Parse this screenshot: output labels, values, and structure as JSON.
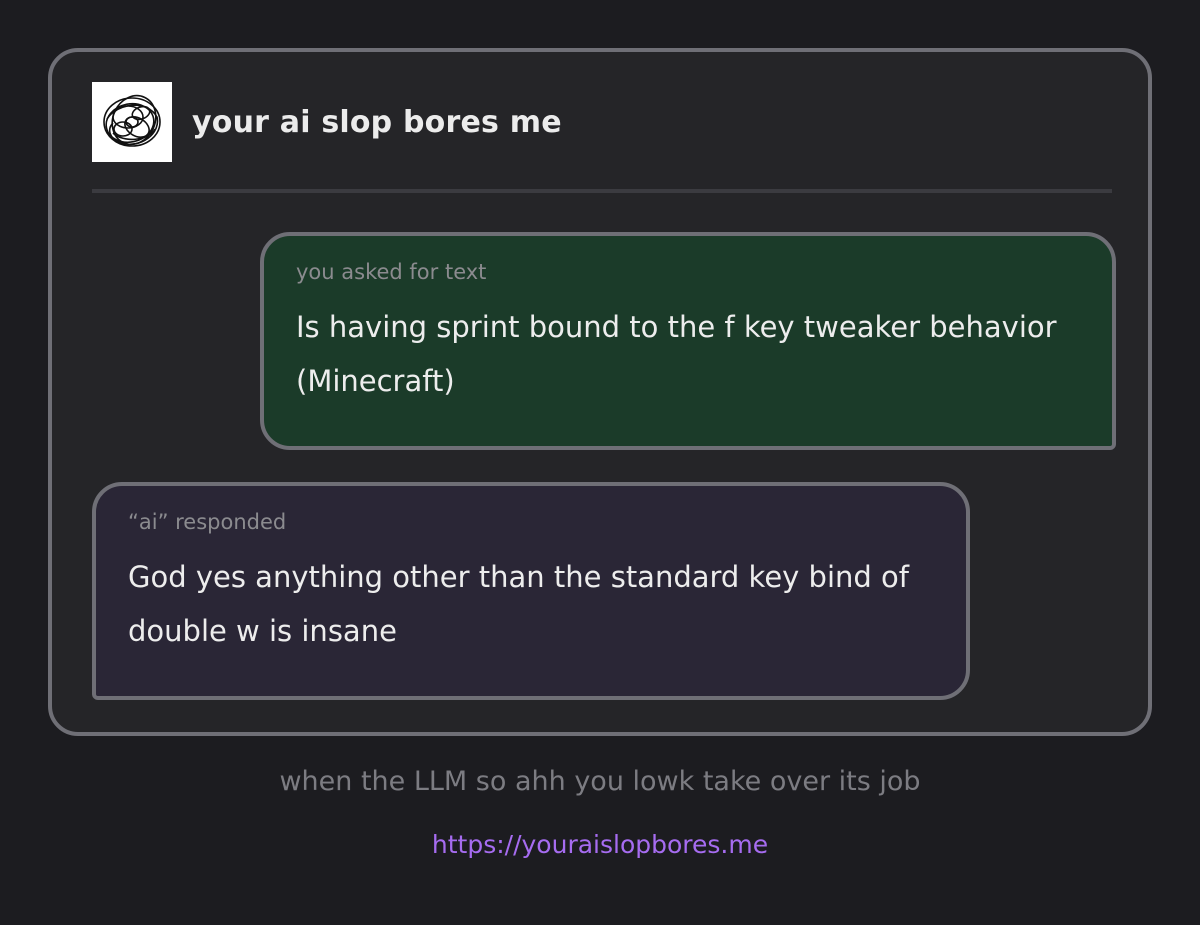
{
  "header": {
    "title": "your ai slop bores me",
    "logo_icon": "scribble-logo-icon"
  },
  "user_message": {
    "label": "you asked for text",
    "text": "Is having sprint bound to the f key tweaker behavior (Minecraft)"
  },
  "ai_message": {
    "label": "“ai” responded",
    "text": "God yes anything other than the standard key bind of double w is insane"
  },
  "footer": {
    "caption": "when the LLM so ahh you lowk take over its job",
    "link": "https://youraislopbores.me"
  },
  "colors": {
    "background": "#1c1c20",
    "card": "#252528",
    "border": "#6f6f76",
    "user_bubble": "#1b3b29",
    "ai_bubble": "#2a2636",
    "link": "#a66cf0"
  }
}
